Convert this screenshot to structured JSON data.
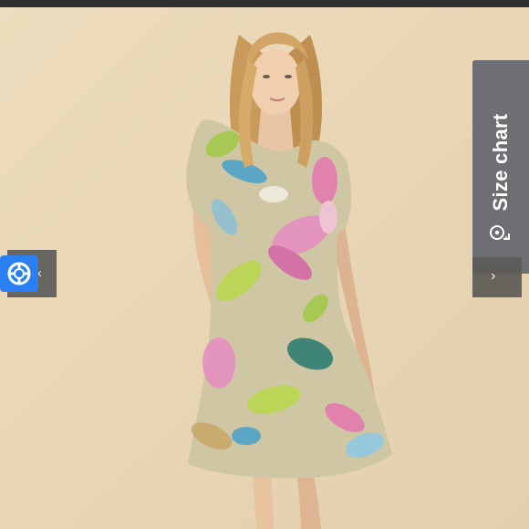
{
  "size_chart": {
    "label": "Size chart",
    "icon": "measuring-tape-icon"
  },
  "navigation": {
    "prev_icon": "chevron-left-icon",
    "next_icon": "chevron-right-icon",
    "badge_icon": "lifebuoy-icon",
    "badge_color": "#2a7ff3"
  },
  "colors": {
    "background": "#e8d6b6",
    "panel": "#6d6f72"
  }
}
